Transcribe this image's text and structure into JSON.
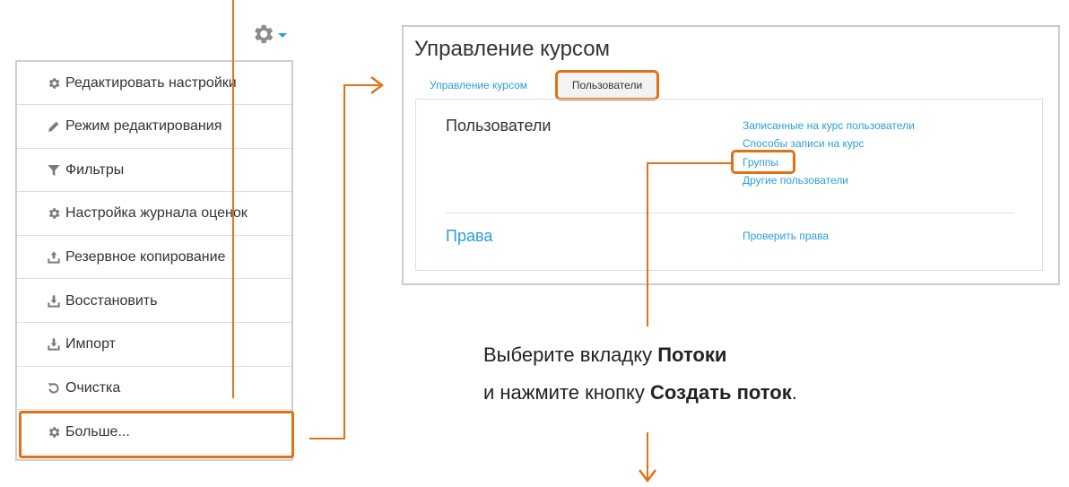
{
  "menu": {
    "items": [
      {
        "label": "Редактировать настройки",
        "icon": "gear-icon"
      },
      {
        "label": "Режим редактирования",
        "icon": "pencil-icon"
      },
      {
        "label": "Фильтры",
        "icon": "filter-icon"
      },
      {
        "label": "Настройка журнала оценок",
        "icon": "gear-icon"
      },
      {
        "label": "Резервное копирование",
        "icon": "upload-icon"
      },
      {
        "label": "Восстановить",
        "icon": "download-icon"
      },
      {
        "label": "Импорт",
        "icon": "download-icon"
      },
      {
        "label": "Очистка",
        "icon": "reset-icon"
      },
      {
        "label": "Больше...",
        "icon": "gear-icon"
      }
    ]
  },
  "course_admin": {
    "title": "Управление курсом",
    "tabs": [
      {
        "label": "Управление курсом",
        "active": false
      },
      {
        "label": "Пользователи",
        "active": true
      }
    ],
    "users_section": {
      "title": "Пользователи",
      "links": [
        "Записанные на курс пользователи",
        "Способы записи на курс",
        "Группы",
        "Другие пользователи"
      ]
    },
    "rights_section": {
      "title": "Права",
      "links": [
        "Проверить права"
      ]
    }
  },
  "instruction": {
    "line1_prefix": "Выберите вкладку ",
    "line1_bold": "Потоки",
    "line2_prefix": "и нажмите кнопку ",
    "line2_bold": "Создать поток",
    "line2_suffix": "."
  },
  "colors": {
    "accent": "#e07215",
    "link": "#2a9fd6",
    "icon": "#7a7a7a",
    "border": "#cfcfcf"
  }
}
